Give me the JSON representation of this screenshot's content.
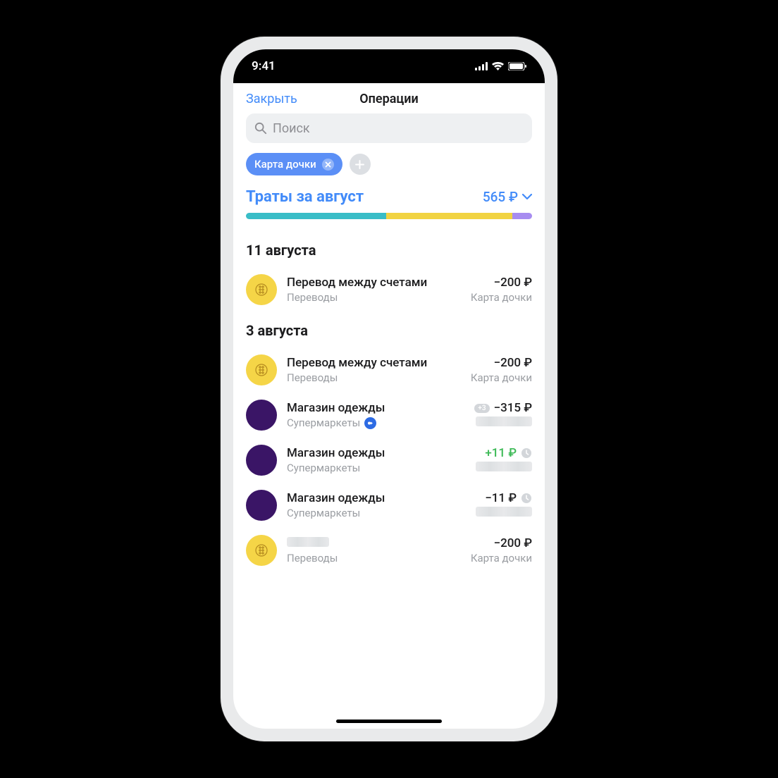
{
  "status": {
    "time": "9:41"
  },
  "nav": {
    "close": "Закрыть",
    "title": "Операции"
  },
  "search": {
    "placeholder": "Поиск"
  },
  "chip": {
    "label": "Карта дочки"
  },
  "summary": {
    "prefix": "Траты за ",
    "month": "август",
    "amount": "565 ₽"
  },
  "bar": {
    "seg1_pct": 49,
    "seg2_pct": 44,
    "seg3_pct": 7
  },
  "sections": [
    {
      "date": "11 августа",
      "tx": [
        {
          "icon": "yellow",
          "title": "Перевод между счетами",
          "cat": "Переводы",
          "amount": "−200 ₽",
          "sub": "Карта дочки"
        }
      ]
    },
    {
      "date": "3 августа",
      "tx": [
        {
          "icon": "yellow",
          "title": "Перевод между счетами",
          "cat": "Переводы",
          "amount": "−200 ₽",
          "sub": "Карта дочки"
        },
        {
          "icon": "purple",
          "title": "Магазин одежды",
          "cat": "Супермаркеты",
          "cat_badge": true,
          "amount": "−315 ₽",
          "pill": "+3",
          "sub_blur": true
        },
        {
          "icon": "purple",
          "title": "Магазин одежды",
          "cat": "Супермаркеты",
          "amount": "+11 ₽",
          "green": true,
          "clock": true,
          "sub_blur": true
        },
        {
          "icon": "purple",
          "title": "Магазин одежды",
          "cat": "Супермаркеты",
          "amount": "−11 ₽",
          "clock": true,
          "sub_blur": true
        },
        {
          "icon": "yellow",
          "title_blur": true,
          "cat": "Переводы",
          "amount": "−200 ₽",
          "sub": "Карта дочки"
        }
      ]
    }
  ]
}
